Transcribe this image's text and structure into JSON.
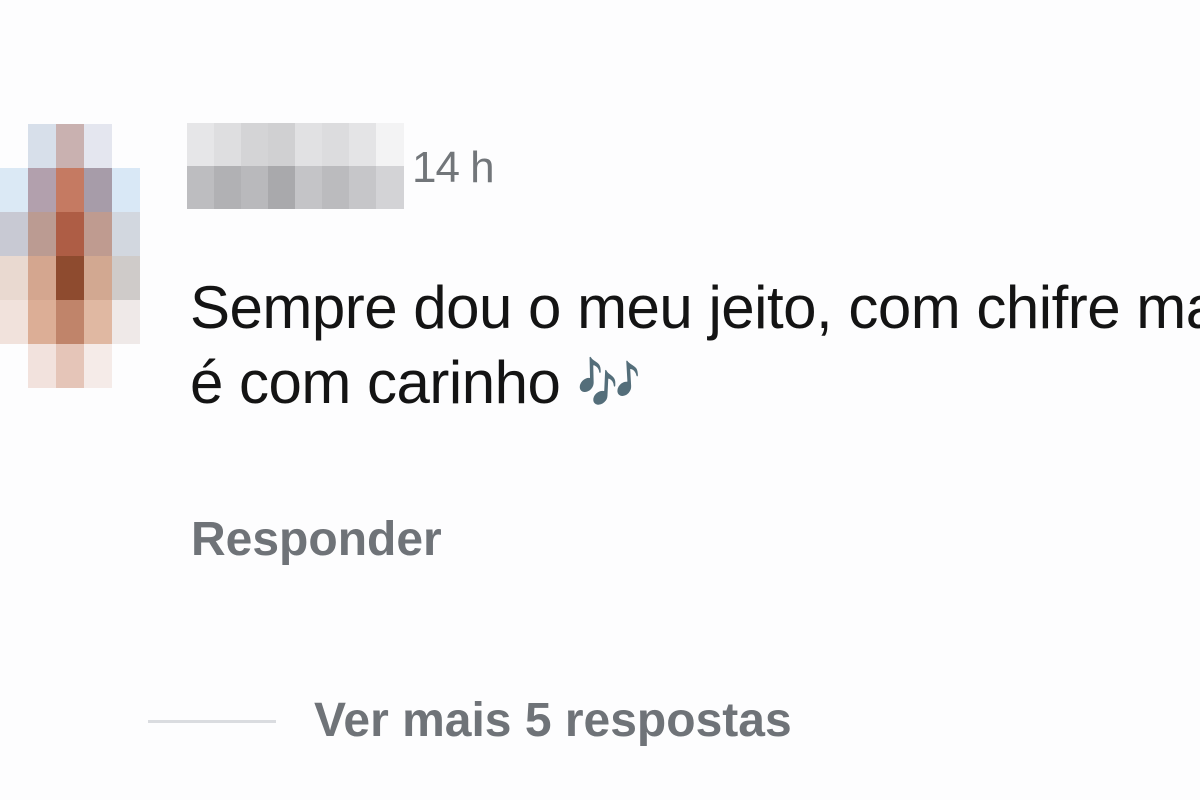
{
  "comment": {
    "timestamp": "14 h",
    "text_line1": "Sempre dou o meu jeito, com chifre mas",
    "text_line2": "é com carinho",
    "emoji": "🎶",
    "emoji_icon": "musical-notes-icon",
    "reply_label": "Responder",
    "more_replies_label": "Ver mais 5 respostas"
  },
  "colors": {
    "text": "#141414",
    "muted": "#6f7378",
    "emoji": "#a15fd2",
    "divider": "#dadce0"
  }
}
